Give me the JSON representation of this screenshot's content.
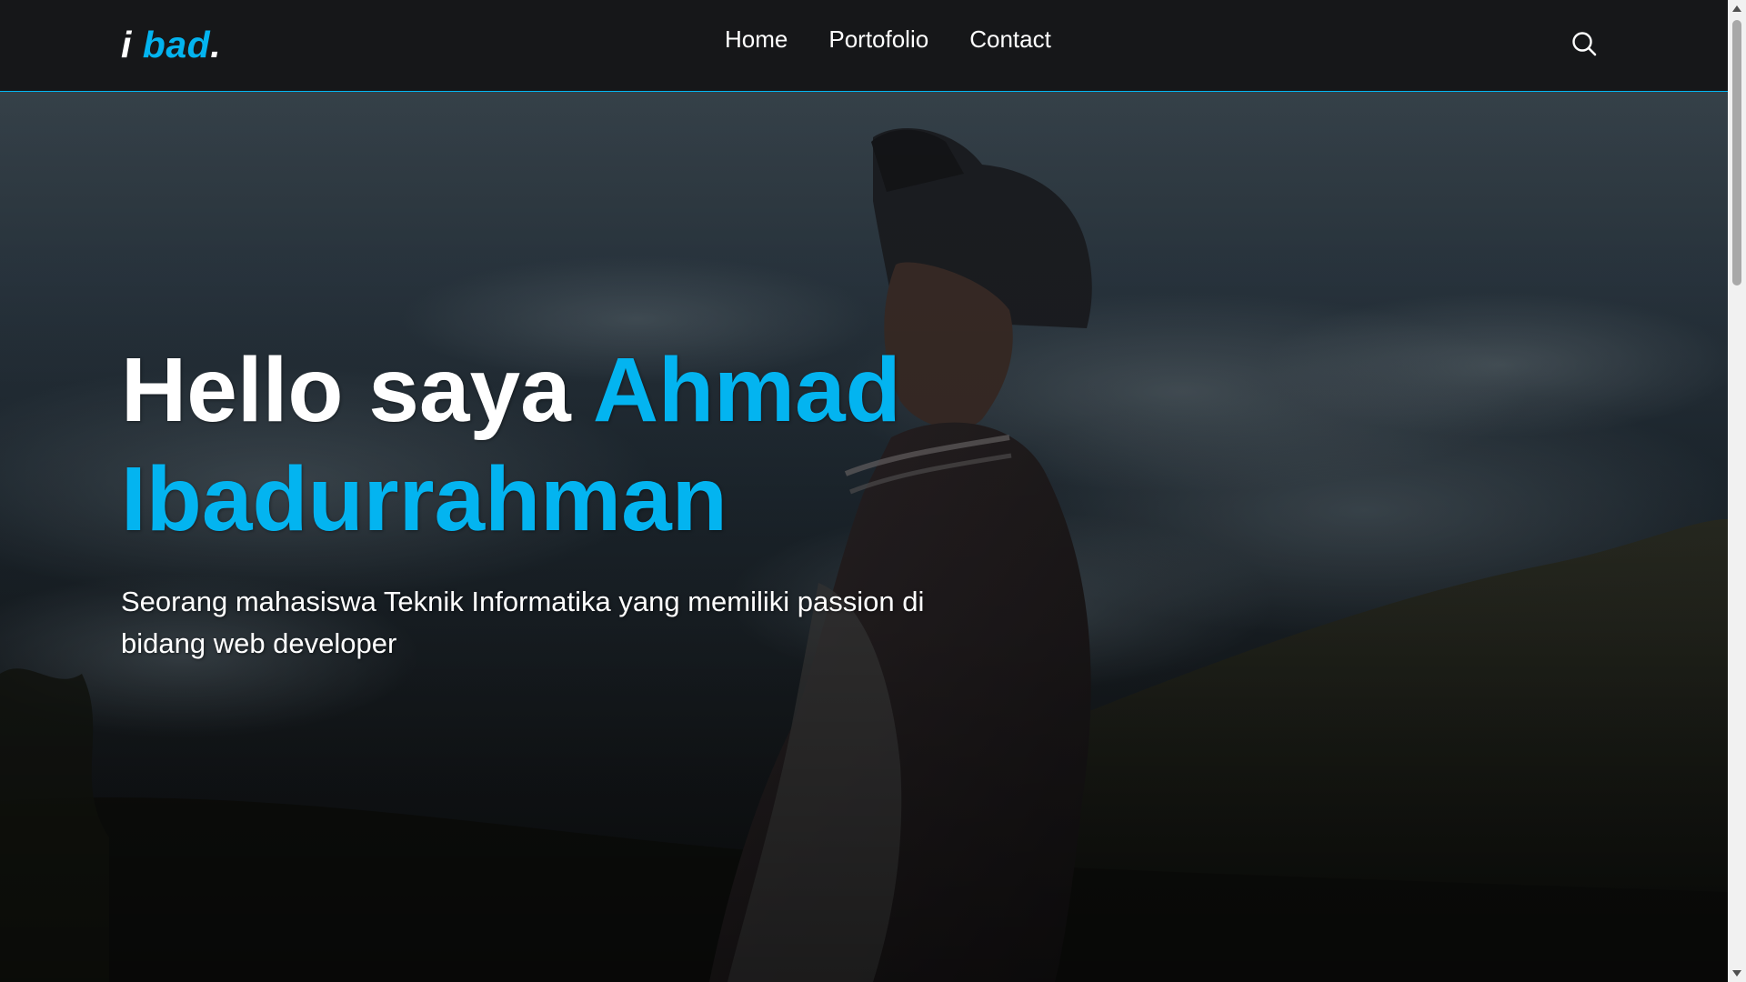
{
  "navbar": {
    "brand_prefix": "i ",
    "brand_accent": "bad",
    "brand_suffix": ".",
    "links": [
      {
        "label": "Home"
      },
      {
        "label": "Portofolio"
      },
      {
        "label": "Contact"
      }
    ],
    "search_icon": "search-icon"
  },
  "hero": {
    "title_prefix": "Hello saya ",
    "title_name": "Ahmad Ibadurrahman",
    "subtitle": "Seorang mahasiswa Teknik Informatika yang memiliki passion di bidang web developer"
  },
  "colors": {
    "accent": "#03b4f0",
    "navbar_bg": "#161719",
    "text": "#ffffff"
  }
}
